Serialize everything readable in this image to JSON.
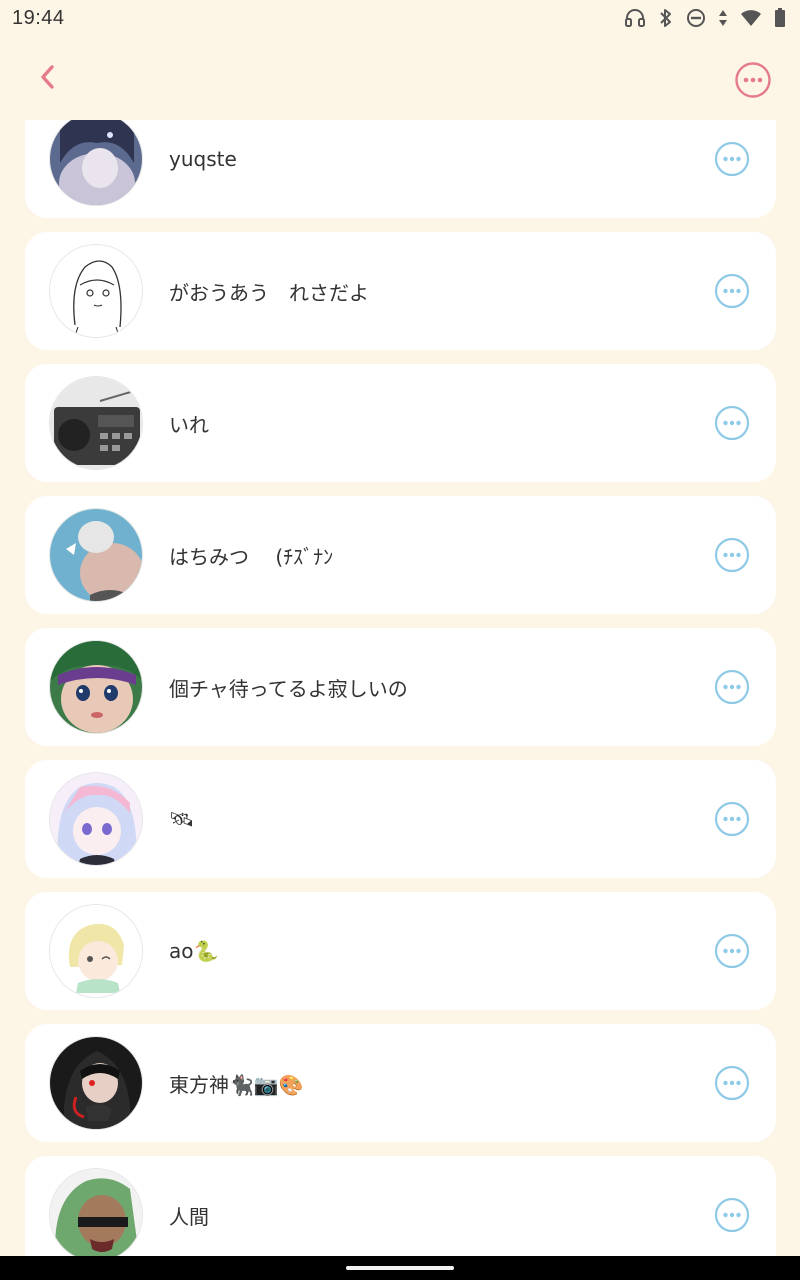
{
  "status_bar": {
    "time": "19:44",
    "icons": [
      "headphones-icon",
      "bluetooth-icon",
      "do-not-disturb-icon",
      "data-arrows-icon",
      "wifi-icon",
      "battery-icon"
    ]
  },
  "app_bar": {
    "back_icon": "chevron-left-icon",
    "menu_icon": "more-circle-icon",
    "accent_color": "#e57a8a"
  },
  "list": {
    "more_icon": "more-circle-icon",
    "more_icon_color": "#8ecae6",
    "items": [
      {
        "name": "yuqste"
      },
      {
        "name": "がおうあう　れさだよ"
      },
      {
        "name": "いれ"
      },
      {
        "name": "はちみつ　 (ﾁｽﾞﾅﾝ"
      },
      {
        "name": "個チャ待ってるよ寂しいの"
      },
      {
        "name": "🛰"
      },
      {
        "name": "ao🐍"
      },
      {
        "name": "東方神🐈‍⬛📷🎨"
      },
      {
        "name": "人間"
      }
    ]
  },
  "colors": {
    "background": "#fdf5e6",
    "card": "#ffffff"
  }
}
